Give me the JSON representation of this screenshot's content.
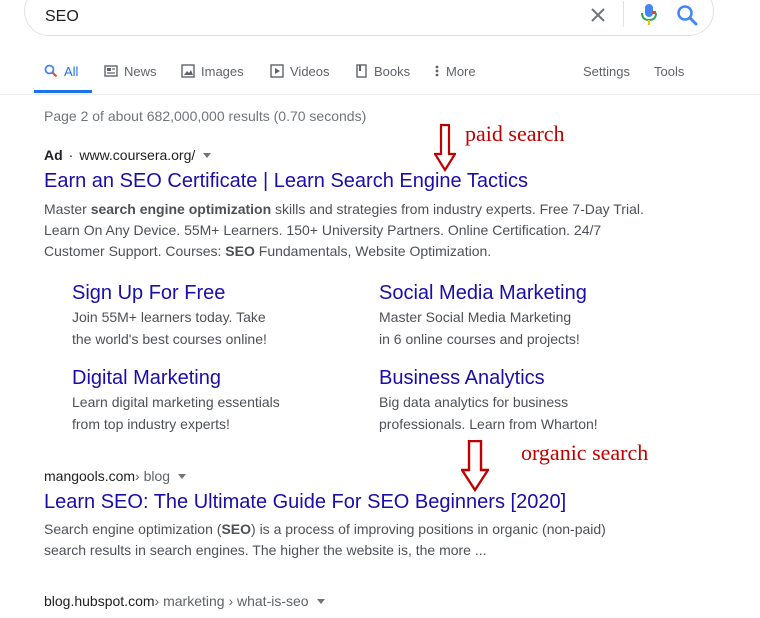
{
  "search": {
    "query": "SEO"
  },
  "tabs": [
    {
      "label": "All",
      "icon": "search-icon"
    },
    {
      "label": "News",
      "icon": "news-icon"
    },
    {
      "label": "Images",
      "icon": "images-icon"
    },
    {
      "label": "Videos",
      "icon": "videos-icon"
    },
    {
      "label": "Books",
      "icon": "books-icon"
    },
    {
      "label": "More",
      "icon": "more-dots-icon"
    }
  ],
  "tools": {
    "settings": "Settings",
    "tools": "Tools"
  },
  "stats": "Page 2 of about 682,000,000 results (0.70 seconds)",
  "ad": {
    "label": "Ad",
    "separator": "·",
    "url": "www.coursera.org/",
    "title": "Earn an SEO Certificate | Learn Search Engine Tactics",
    "snippet": {
      "line1_pre": "Master ",
      "line1_bold": "search engine optimization",
      "line1_post": " skills and strategies from industry experts. Free 7-Day Trial.",
      "line2": "Learn On Any Device. 55M+ Learners. 150+ University Partners. Online Certification. 24/7",
      "line3_pre": "Customer Support. Courses: ",
      "line3_bold": "SEO",
      "line3_post": " Fundamentals, Website Optimization."
    },
    "sitelinks": [
      {
        "title": "Sign Up For Free",
        "line1": "Join 55M+ learners today. Take",
        "line2": "the world's best courses online!"
      },
      {
        "title": "Social Media Marketing",
        "line1": "Master Social Media Marketing",
        "line2": "in 6 online courses and projects!"
      },
      {
        "title": "Digital Marketing",
        "line1": "Learn digital marketing essentials",
        "line2": "from top industry experts!"
      },
      {
        "title": "Business Analytics",
        "line1": "Big data analytics for business",
        "line2": "professionals. Learn from Wharton!"
      }
    ]
  },
  "results": [
    {
      "domain": "mangools.com",
      "path": " › blog",
      "title": "Learn SEO: The Ultimate Guide For SEO Beginners [2020]",
      "line1_pre": "Search engine optimization (",
      "line1_bold": "SEO",
      "line1_post": ") is a process of improving positions in organic (non-paid)",
      "line2": "search results in search engines. The higher the website is, the more ..."
    },
    {
      "domain": "blog.hubspot.com",
      "path": " › marketing › what-is-seo"
    }
  ],
  "annotations": {
    "paid": "paid search",
    "organic": "organic search"
  },
  "colors": {
    "link": "#1a0dab",
    "accent": "#1a73e8",
    "annotation": "#c00000"
  }
}
